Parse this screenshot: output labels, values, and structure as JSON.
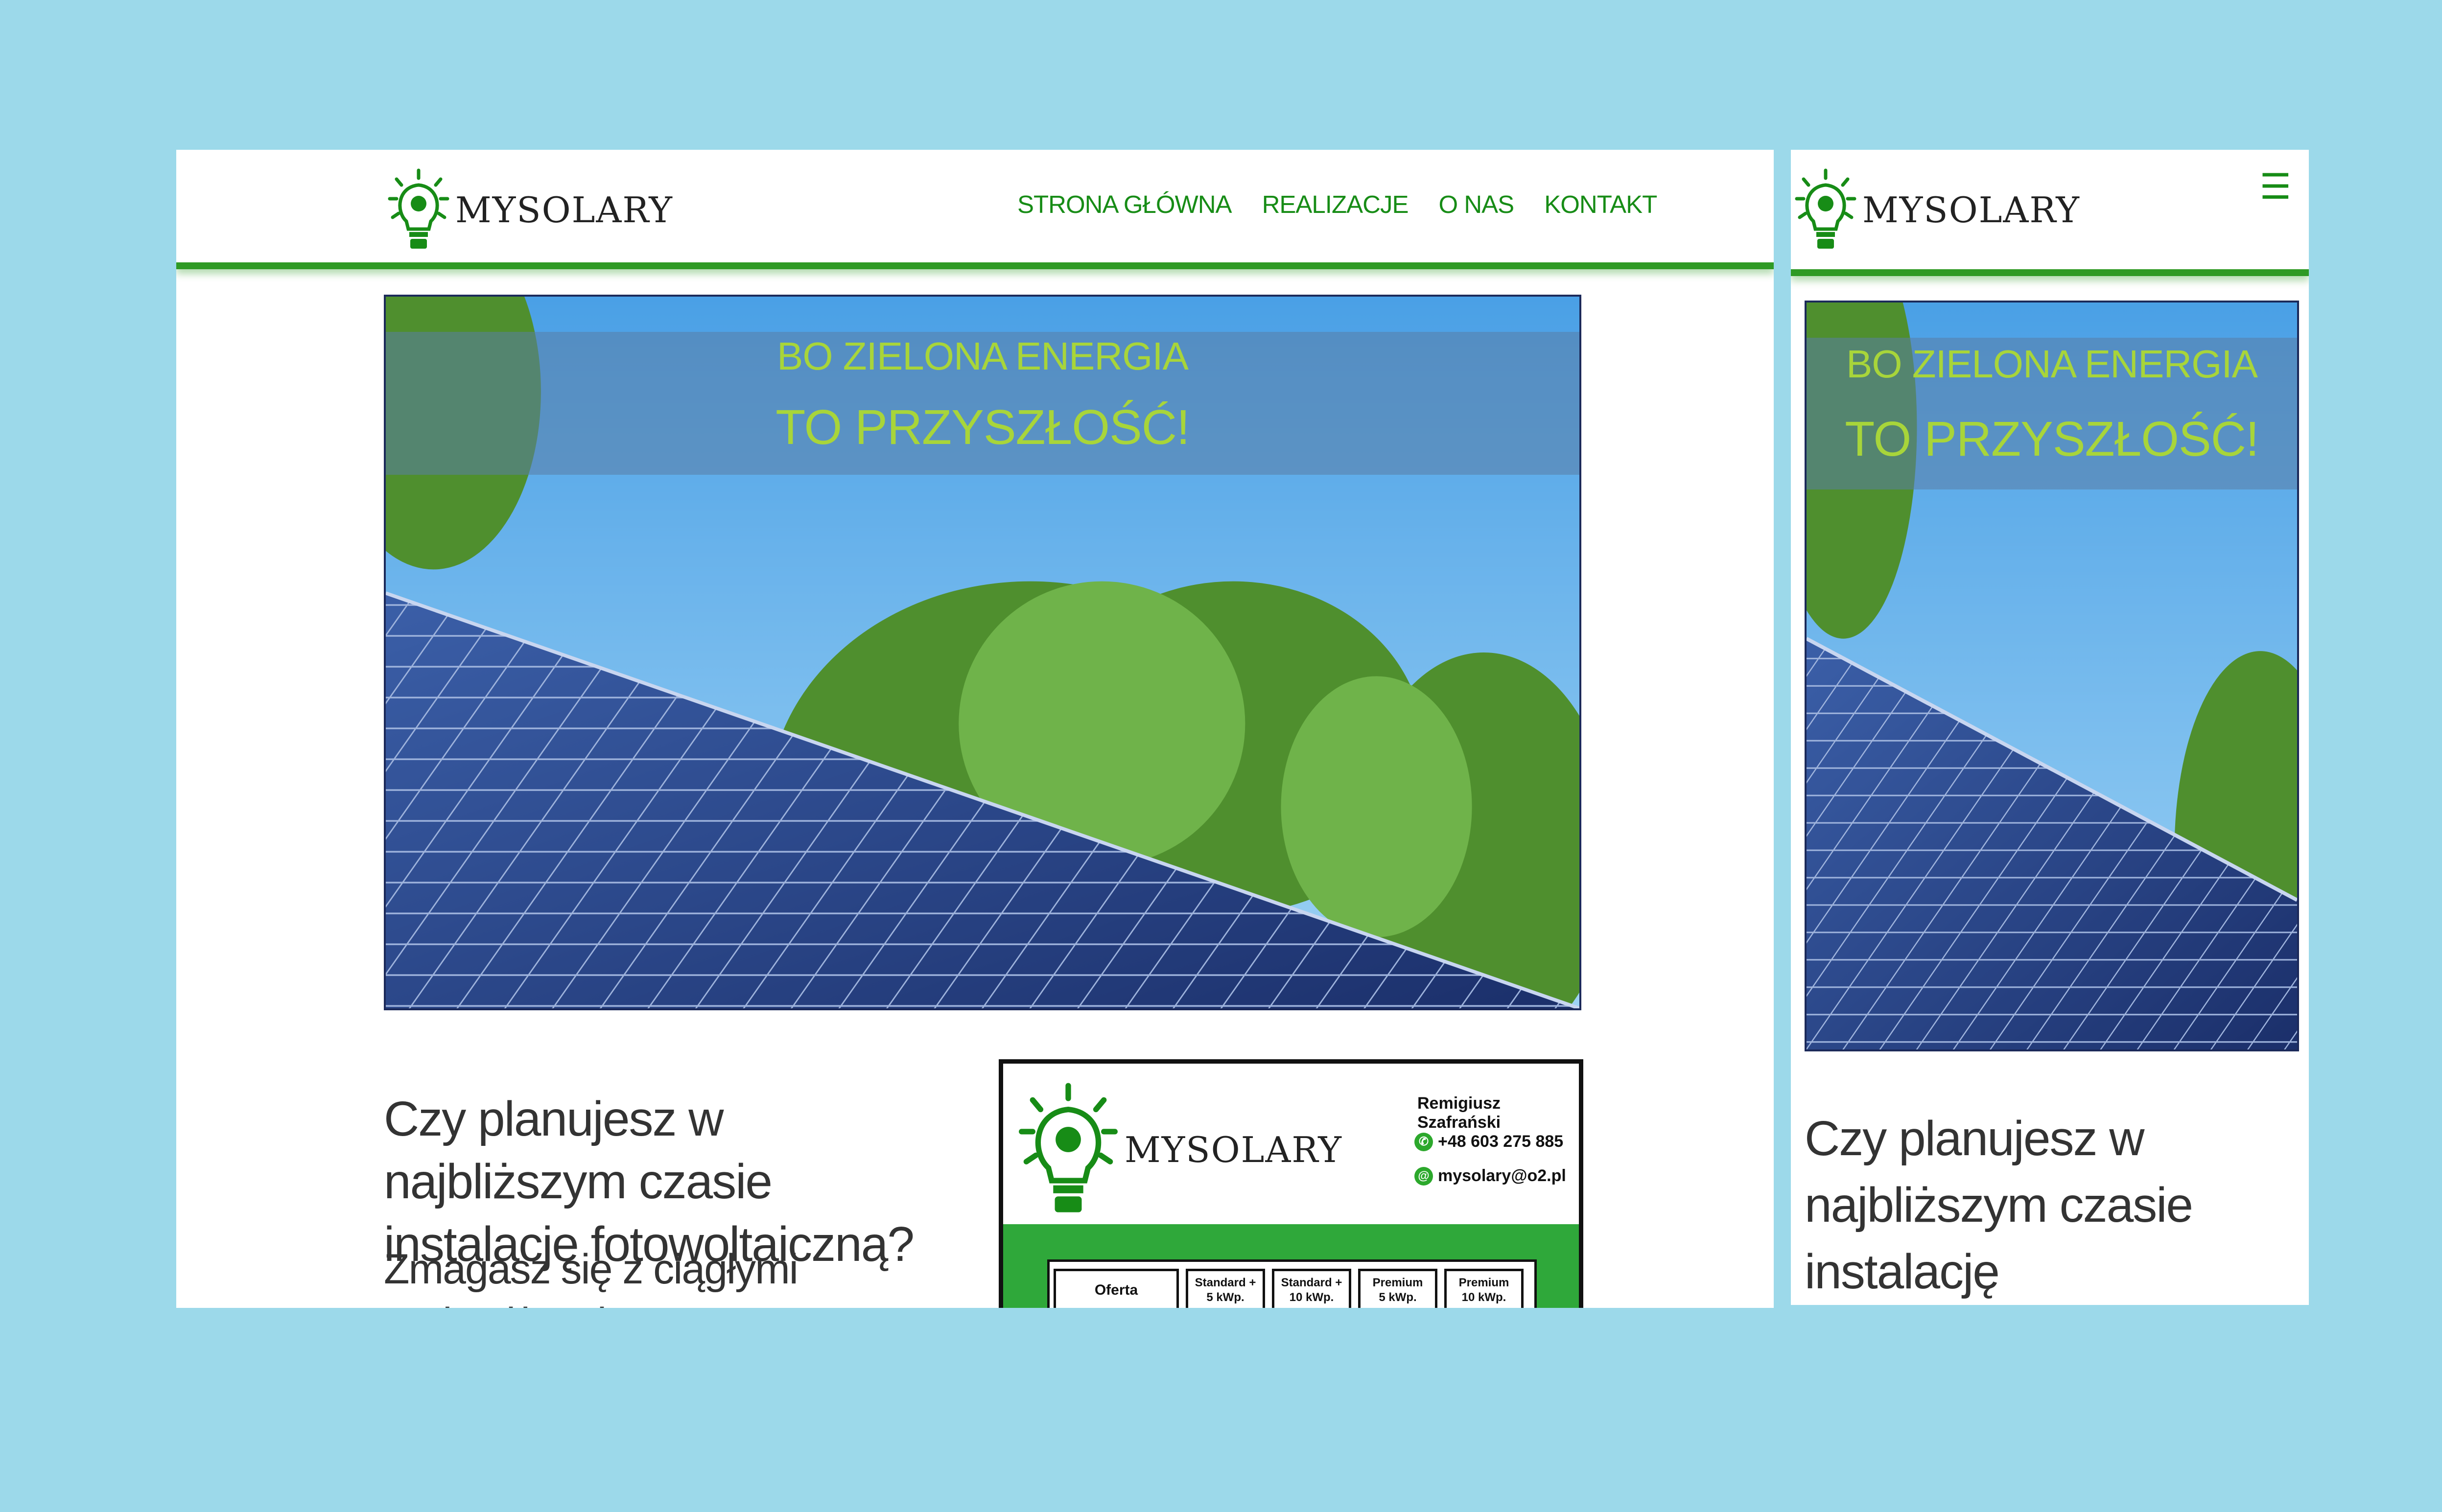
{
  "brand": {
    "name": "MYSOLARY",
    "accent": "#178c16",
    "hero_text_color": "#a8d53a",
    "background": "#9cd9ea"
  },
  "nav": {
    "items": [
      "STRONA GŁÓWNA",
      "REALIZACJE",
      "O NAS",
      "KONTAKT"
    ]
  },
  "mobile_nav": {
    "menu_icon": "☰"
  },
  "hero": {
    "line1": "BO ZIELONA ENERGIA",
    "line2": "TO PRZYSZŁOŚĆ!"
  },
  "intro": {
    "heading": "Czy planujesz w najbliższym czasie instalację fotowoltaiczną?",
    "body": "Zmagasz się z ciągłymi podwyżkami"
  },
  "flyer": {
    "brand": "MYSOLARY",
    "name": "Remigiusz Szafrański",
    "phone": "+48 603 275 885",
    "email": "mysolary@o2.pl",
    "table_header": "Oferta",
    "options": [
      {
        "line1": "Standard +",
        "line2": "5 kWp."
      },
      {
        "line1": "Standard +",
        "line2": "10 kWp."
      },
      {
        "line1": "Premium",
        "line2": "5 kWp."
      },
      {
        "line1": "Premium",
        "line2": "10 kWp."
      }
    ]
  }
}
